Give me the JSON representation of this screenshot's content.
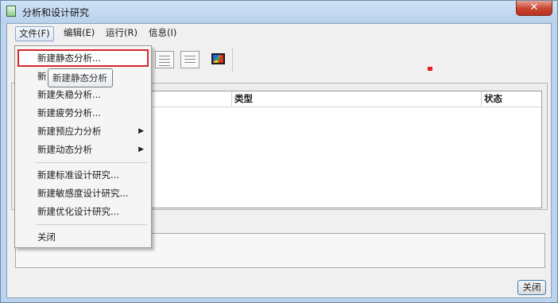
{
  "window": {
    "title": "分析和设计研究",
    "close_symbol": "✕"
  },
  "menubar": {
    "items": [
      "文件(F)",
      "编辑(E)",
      "运行(R)",
      "信息(I)"
    ]
  },
  "toolbar": {
    "icons": [
      "list-icon",
      "list-properties-icon",
      "results-display-icon"
    ]
  },
  "table": {
    "columns": [
      "类型",
      "状态"
    ]
  },
  "file_menu": {
    "items": [
      {
        "label": "新建静态分析...",
        "highlighted": true
      },
      {
        "label": "新建模态分析...",
        "visible_text": "新"
      },
      {
        "label": "新建失稳分析..."
      },
      {
        "label": "新建疲劳分析..."
      },
      {
        "label": "新建预应力分析",
        "submenu": true
      },
      {
        "label": "新建动态分析",
        "submenu": true
      },
      {
        "label": "新建标准设计研究..."
      },
      {
        "label": "新建敏感度设计研究..."
      },
      {
        "label": "新建优化设计研究..."
      },
      {
        "label": "关闭"
      }
    ],
    "submenu_arrow": "▶"
  },
  "tooltip": {
    "text": "新建静态分析"
  },
  "footer": {
    "close_label": "关闭"
  },
  "colors": {
    "highlight_border": "#d7262c",
    "marker": "#e02020",
    "titlebar": "#c4d9f1"
  }
}
